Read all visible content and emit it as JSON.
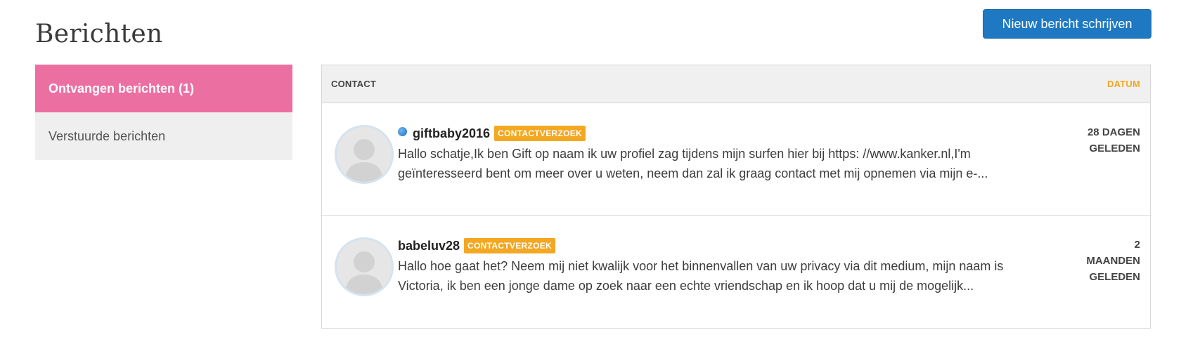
{
  "page": {
    "title": "Berichten",
    "compose_label": "Nieuw bericht schrijven"
  },
  "sidebar": {
    "items": [
      {
        "label": "Ontvangen berichten (1)",
        "active": true
      },
      {
        "label": "Verstuurde berichten",
        "active": false
      }
    ]
  },
  "inbox": {
    "columns": {
      "contact": "CONTACT",
      "date": "DATUM"
    },
    "messages": [
      {
        "sender": "giftbaby2016",
        "online": true,
        "badge": "CONTACTVERZOEK",
        "preview_line1": "Hallo schatje,Ik ben Gift op naam ik uw profiel zag tijdens mijn surfen hier bij https: //www.kanker.nl,I'm",
        "preview_line2": "geïnteresseerd bent om meer over u weten, neem dan zal ik graag contact met mij opnemen via mijn e-...",
        "date_line1": "28 DAGEN",
        "date_line2": "GELEDEN",
        "date_line3": ""
      },
      {
        "sender": "babeluv28",
        "online": false,
        "badge": "CONTACTVERZOEK",
        "preview_line1": "Hallo hoe gaat het? Neem mij niet kwalijk voor het binnenvallen van uw privacy via dit medium, mijn naam is",
        "preview_line2": "Victoria, ik ben een jonge dame op zoek naar een echte vriendschap en ik hoop dat u mij de mogelijk...",
        "date_line1": "2",
        "date_line2": "MAANDEN",
        "date_line3": "GELEDEN"
      }
    ]
  },
  "colors": {
    "accent_pink": "#ec6fa2",
    "button_blue": "#1f79c2",
    "badge_orange": "#f4a721",
    "online_blue": "#1e6fbf"
  },
  "icons": {
    "avatar": "default-avatar-silhouette-icon",
    "online": "online-status-dot-icon"
  }
}
